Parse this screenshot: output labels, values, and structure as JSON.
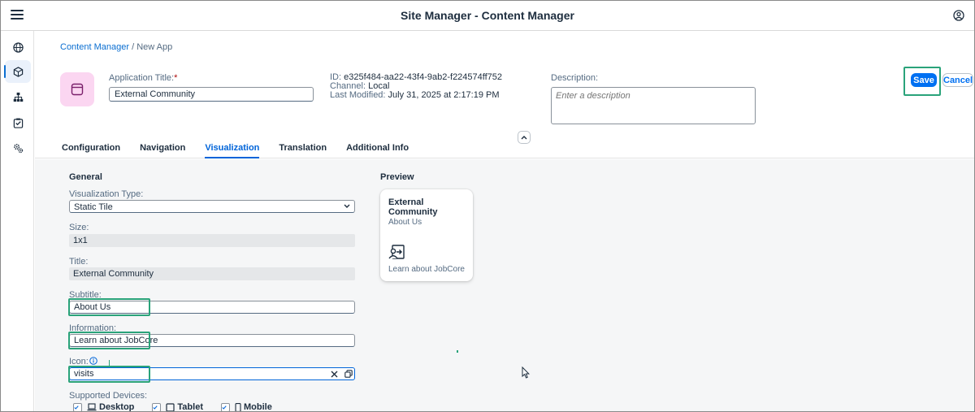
{
  "shell": {
    "title": "Site Manager - Content Manager",
    "menu_icon": "hamburger-menu-icon",
    "user_icon": "user-account-icon"
  },
  "rail": {
    "items": [
      {
        "icon": "globe-icon",
        "active": false
      },
      {
        "icon": "cube-icon",
        "active": true
      },
      {
        "icon": "hierarchy-icon",
        "active": false
      },
      {
        "icon": "checklist-icon",
        "active": false
      },
      {
        "icon": "settings-icon",
        "active": false
      }
    ]
  },
  "breadcrumb": {
    "link": "Content Manager",
    "separator": "/",
    "current": "New App"
  },
  "header": {
    "title_label": "Application Title:",
    "required_marker": "*",
    "title_value": "External Community",
    "id_label": "ID:",
    "id_value": "e325f484-aa22-43f4-9ab2-f224574ff752",
    "channel_label": "Channel:",
    "channel_value": "Local",
    "modified_label": "Last Modified:",
    "modified_value": "July 31, 2025 at 2:17:19 PM",
    "description_label": "Description:",
    "description_placeholder": "Enter a description",
    "save_label": "Save",
    "cancel_label": "Cancel"
  },
  "tabs": [
    {
      "label": "Configuration",
      "active": false
    },
    {
      "label": "Navigation",
      "active": false
    },
    {
      "label": "Visualization",
      "active": true
    },
    {
      "label": "Translation",
      "active": false
    },
    {
      "label": "Additional Info",
      "active": false
    }
  ],
  "general": {
    "section_title": "General",
    "viz_type_label": "Visualization Type:",
    "viz_type_value": "Static Tile",
    "size_label": "Size:",
    "size_value": "1x1",
    "title_label": "Title:",
    "title_value": "External Community",
    "subtitle_label": "Subtitle:",
    "subtitle_value": "About Us",
    "information_label": "Information:",
    "information_value": "Learn about JobCore",
    "icon_label": "Icon:",
    "icon_value": "visits",
    "devices_label": "Supported Devices:",
    "devices": [
      {
        "label": "Desktop",
        "checked": true,
        "icon": "laptop-icon"
      },
      {
        "label": "Tablet",
        "checked": true,
        "icon": "tablet-icon"
      },
      {
        "label": "Mobile",
        "checked": true,
        "icon": "phone-icon"
      }
    ]
  },
  "preview": {
    "section_title": "Preview",
    "tile_title": "External Community",
    "tile_subtitle": "About Us",
    "tile_icon": "visits-icon",
    "tile_info": "Learn about JobCore"
  },
  "colors": {
    "brand": "#0070f2",
    "highlight": "#2aa37a",
    "avatar_bg": "#fbd6f1"
  }
}
